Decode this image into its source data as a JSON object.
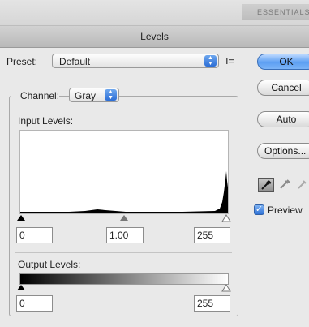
{
  "workspace": {
    "label": "ESSENTIALS"
  },
  "dialog": {
    "title": "Levels"
  },
  "preset": {
    "label": "Preset:",
    "value": "Default",
    "menu_icon": "list-menu-icon"
  },
  "channel": {
    "label": "Channel:",
    "value": "Gray"
  },
  "input_levels": {
    "label": "Input Levels:",
    "shadow": "0",
    "midtone": "1.00",
    "highlight": "255"
  },
  "output_levels": {
    "label": "Output Levels:",
    "shadow": "0",
    "highlight": "255"
  },
  "buttons": {
    "ok": "OK",
    "cancel": "Cancel",
    "auto": "Auto",
    "options": "Options..."
  },
  "preview": {
    "label": "Preview",
    "checked": true
  },
  "eyedroppers": [
    "black-eyedropper-icon",
    "gray-eyedropper-icon",
    "white-eyedropper-icon"
  ],
  "colors": {
    "accent": "#2f72d6",
    "ok_button": "#5d9ff2"
  }
}
